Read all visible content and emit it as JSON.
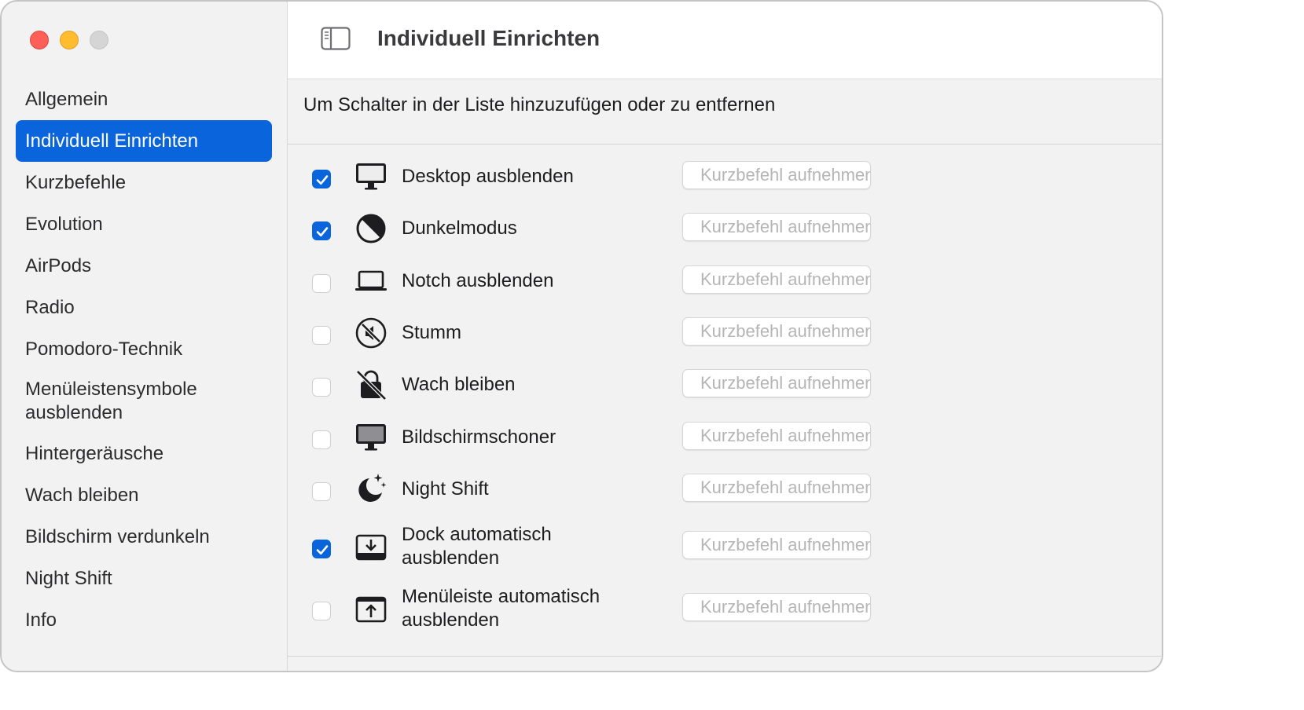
{
  "window": {
    "title": "Individuell Einrichten"
  },
  "sidebar": {
    "items": [
      {
        "label": "Allgemein"
      },
      {
        "label": "Individuell Einrichten",
        "selected": true
      },
      {
        "label": "Kurzbefehle"
      },
      {
        "label": "Evolution"
      },
      {
        "label": "AirPods"
      },
      {
        "label": "Radio"
      },
      {
        "label": "Pomodoro-Technik"
      },
      {
        "label": "Menüleistensymbole ausblenden"
      },
      {
        "label": "Hintergeräusche"
      },
      {
        "label": "Wach bleiben"
      },
      {
        "label": "Bildschirm verdunkeln"
      },
      {
        "label": "Night Shift"
      },
      {
        "label": "Info"
      }
    ]
  },
  "main": {
    "description": "Um Schalter in der Liste hinzuzufügen oder zu entfernen",
    "rows": [
      {
        "label": "Desktop ausblenden",
        "checked": true,
        "icon": "display-icon",
        "shortcut_placeholder": "Kurzbefehl aufnehmen"
      },
      {
        "label": "Dunkelmodus",
        "checked": true,
        "icon": "dark-mode-icon",
        "shortcut_placeholder": "Kurzbefehl aufnehmen"
      },
      {
        "label": "Notch ausblenden",
        "checked": false,
        "icon": "laptop-icon",
        "shortcut_placeholder": "Kurzbefehl aufnehmen"
      },
      {
        "label": "Stumm",
        "checked": false,
        "icon": "mute-icon",
        "shortcut_placeholder": "Kurzbefehl aufnehmen"
      },
      {
        "label": "Wach bleiben",
        "checked": false,
        "icon": "keep-awake-icon",
        "shortcut_placeholder": "Kurzbefehl aufnehmen"
      },
      {
        "label": "Bildschirmschoner",
        "checked": false,
        "icon": "screensaver-icon",
        "shortcut_placeholder": "Kurzbefehl aufnehmen"
      },
      {
        "label": "Night Shift",
        "checked": false,
        "icon": "night-shift-icon",
        "shortcut_placeholder": "Kurzbefehl aufnehmen"
      },
      {
        "label": "Dock automatisch ausblenden",
        "checked": true,
        "icon": "dock-hide-icon",
        "shortcut_placeholder": "Kurzbefehl aufnehmen"
      },
      {
        "label": "Menüleiste automatisch ausblenden",
        "checked": false,
        "icon": "menubar-hide-icon",
        "shortcut_placeholder": "Kurzbefehl aufnehmen"
      }
    ]
  },
  "colors": {
    "accent": "#0a64dc",
    "close": "#fe5f57",
    "minimize": "#febc2e",
    "zoom": "#d5d5d5"
  }
}
